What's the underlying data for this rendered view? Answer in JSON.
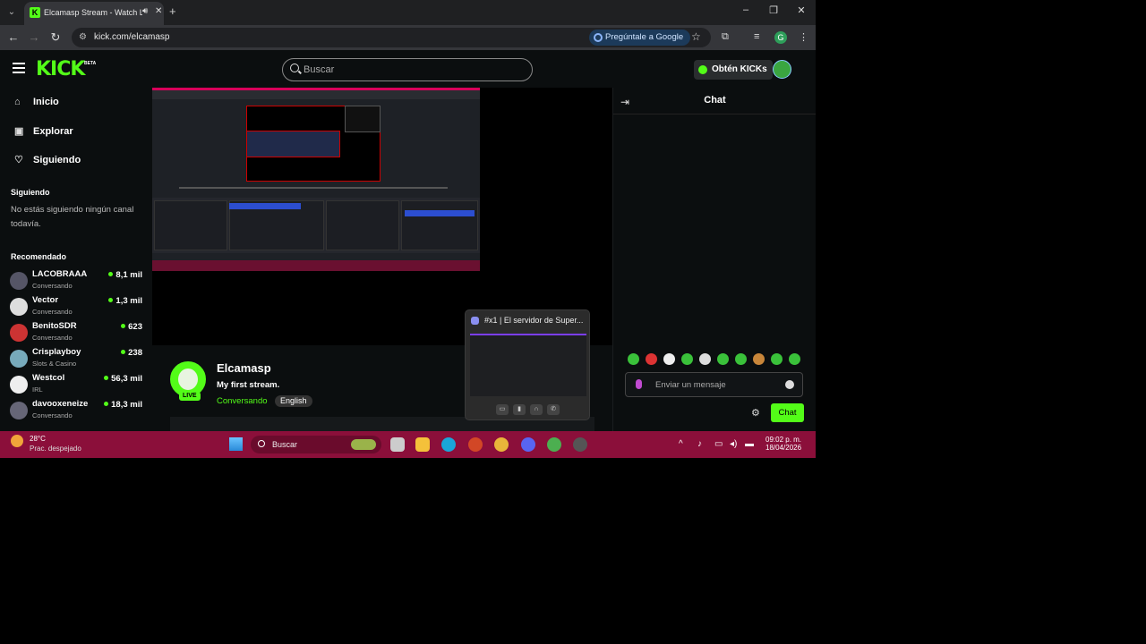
{
  "browser": {
    "tab_title": "Elcamasp Stream - Watch L",
    "url": "kick.com/elcamasp",
    "google_button": "Pregúntale a Google",
    "profile_initial": "G"
  },
  "header": {
    "logo": "KICK",
    "logo_badge": "BETA",
    "search_placeholder": "Buscar",
    "kicks_button": "Obtén KICKs"
  },
  "sidebar": {
    "nav": [
      {
        "label": "Inicio",
        "icon": "home-icon"
      },
      {
        "label": "Explorar",
        "icon": "compass-icon"
      },
      {
        "label": "Siguiendo",
        "icon": "heart-icon"
      }
    ],
    "following_heading": "Siguiendo",
    "following_empty": "No estás siguiendo ningún canal todavía.",
    "recommended_heading": "Recomendado",
    "recommended": [
      {
        "name": "LACOBRAAA",
        "category": "Conversando",
        "viewers": "8,1 mil"
      },
      {
        "name": "Vector",
        "category": "Conversando",
        "viewers": "1,3 mil"
      },
      {
        "name": "BenitoSDR",
        "category": "Conversando",
        "viewers": "623"
      },
      {
        "name": "Crisplayboy",
        "category": "Slots & Casino",
        "viewers": "238"
      },
      {
        "name": "Westcol",
        "category": "IRL",
        "viewers": "56,3 mil"
      },
      {
        "name": "davooxeneize",
        "category": "Conversando",
        "viewers": "18,3 mil"
      }
    ]
  },
  "stream": {
    "channel": "Elcamasp",
    "title": "My first stream.",
    "category": "Conversando",
    "language": "English",
    "live_badge": "LIVE"
  },
  "popup": {
    "title": "#x1 | El servidor de Super..."
  },
  "chat": {
    "title": "Chat",
    "placeholder": "Enviar un mensaje",
    "send_button": "Chat"
  },
  "taskbar": {
    "temperature": "28°C",
    "condition": "Prac. despejado",
    "search": "Buscar",
    "time": "09:02 p. m.",
    "date": "18/04/2026"
  },
  "colors": {
    "kick_green": "#53fc18",
    "taskbar": "#8b0f3a",
    "background": "#0b0e0f"
  }
}
